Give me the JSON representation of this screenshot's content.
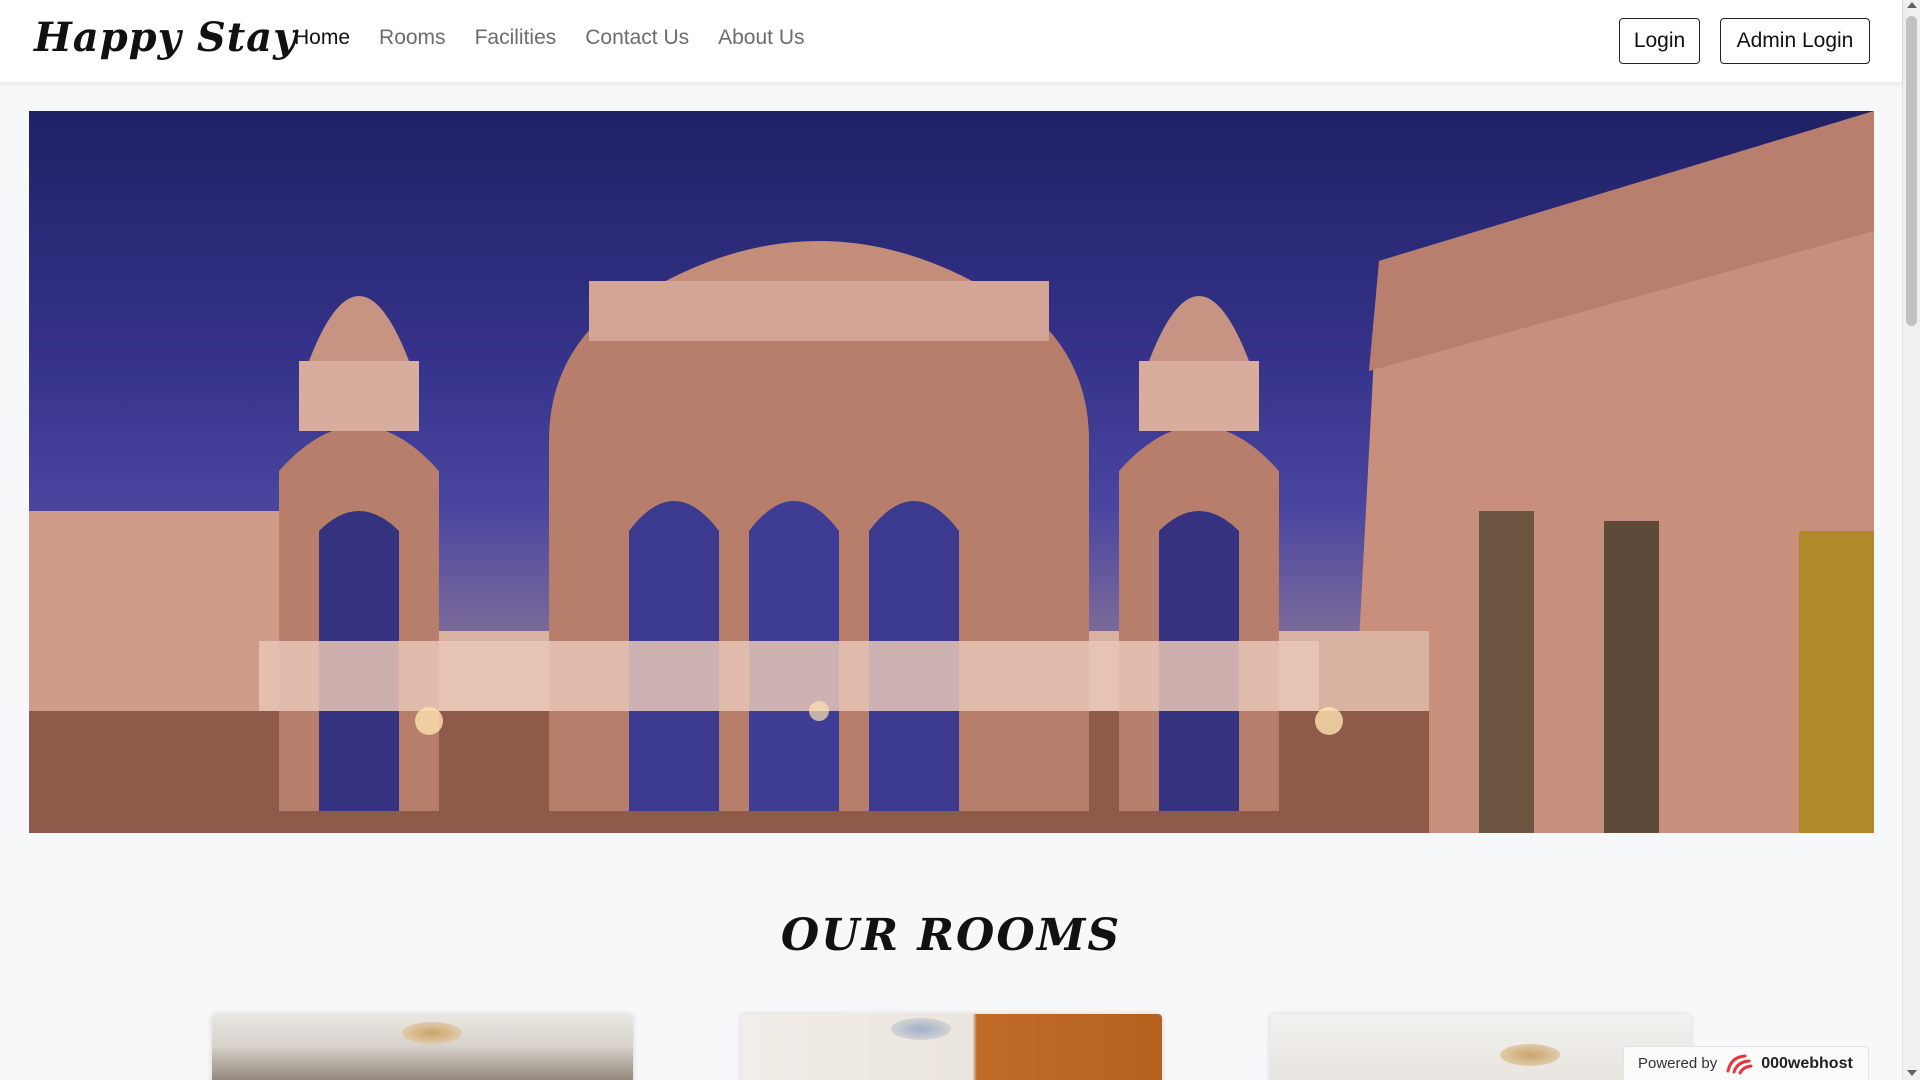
{
  "navbar": {
    "brand": "Happy Stay",
    "links": [
      {
        "label": "Home",
        "active": true
      },
      {
        "label": "Rooms",
        "active": false
      },
      {
        "label": "Facilities",
        "active": false
      },
      {
        "label": "Contact Us",
        "active": false
      },
      {
        "label": "About Us",
        "active": false
      }
    ],
    "login_label": "Login",
    "admin_login_label": "Admin Login"
  },
  "hero": {
    "image": "palace-terrace-photo"
  },
  "rooms_section": {
    "title": "OUR ROOMS",
    "cards": [
      {
        "image": "room-photo-1"
      },
      {
        "image": "room-photo-2"
      },
      {
        "image": "room-photo-3"
      }
    ]
  },
  "badge": {
    "prefix": "Powered by",
    "brand": "000webhost",
    "accent_color": "#e8333c"
  }
}
